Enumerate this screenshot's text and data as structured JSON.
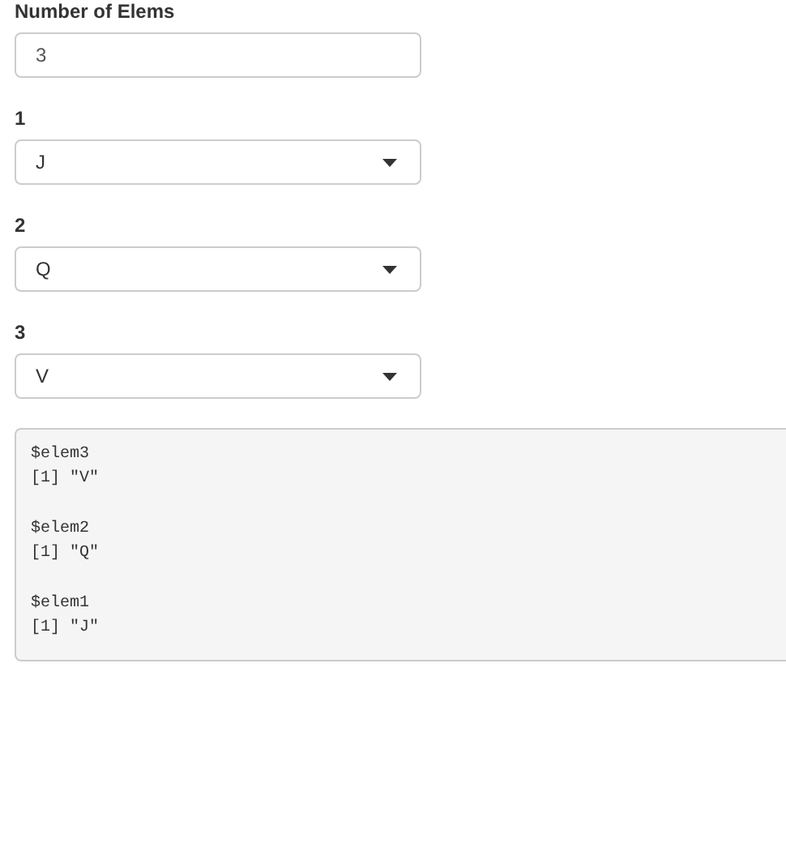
{
  "number_input": {
    "label": "Number of Elems",
    "value": "3"
  },
  "selects": [
    {
      "label": "1",
      "value": "J"
    },
    {
      "label": "2",
      "value": "Q"
    },
    {
      "label": "3",
      "value": "V"
    }
  ],
  "output": [
    {
      "name": "$elem3",
      "value": "[1] \"V\""
    },
    {
      "name": "$elem2",
      "value": "[1] \"Q\""
    },
    {
      "name": "$elem1",
      "value": "[1] \"J\""
    }
  ]
}
